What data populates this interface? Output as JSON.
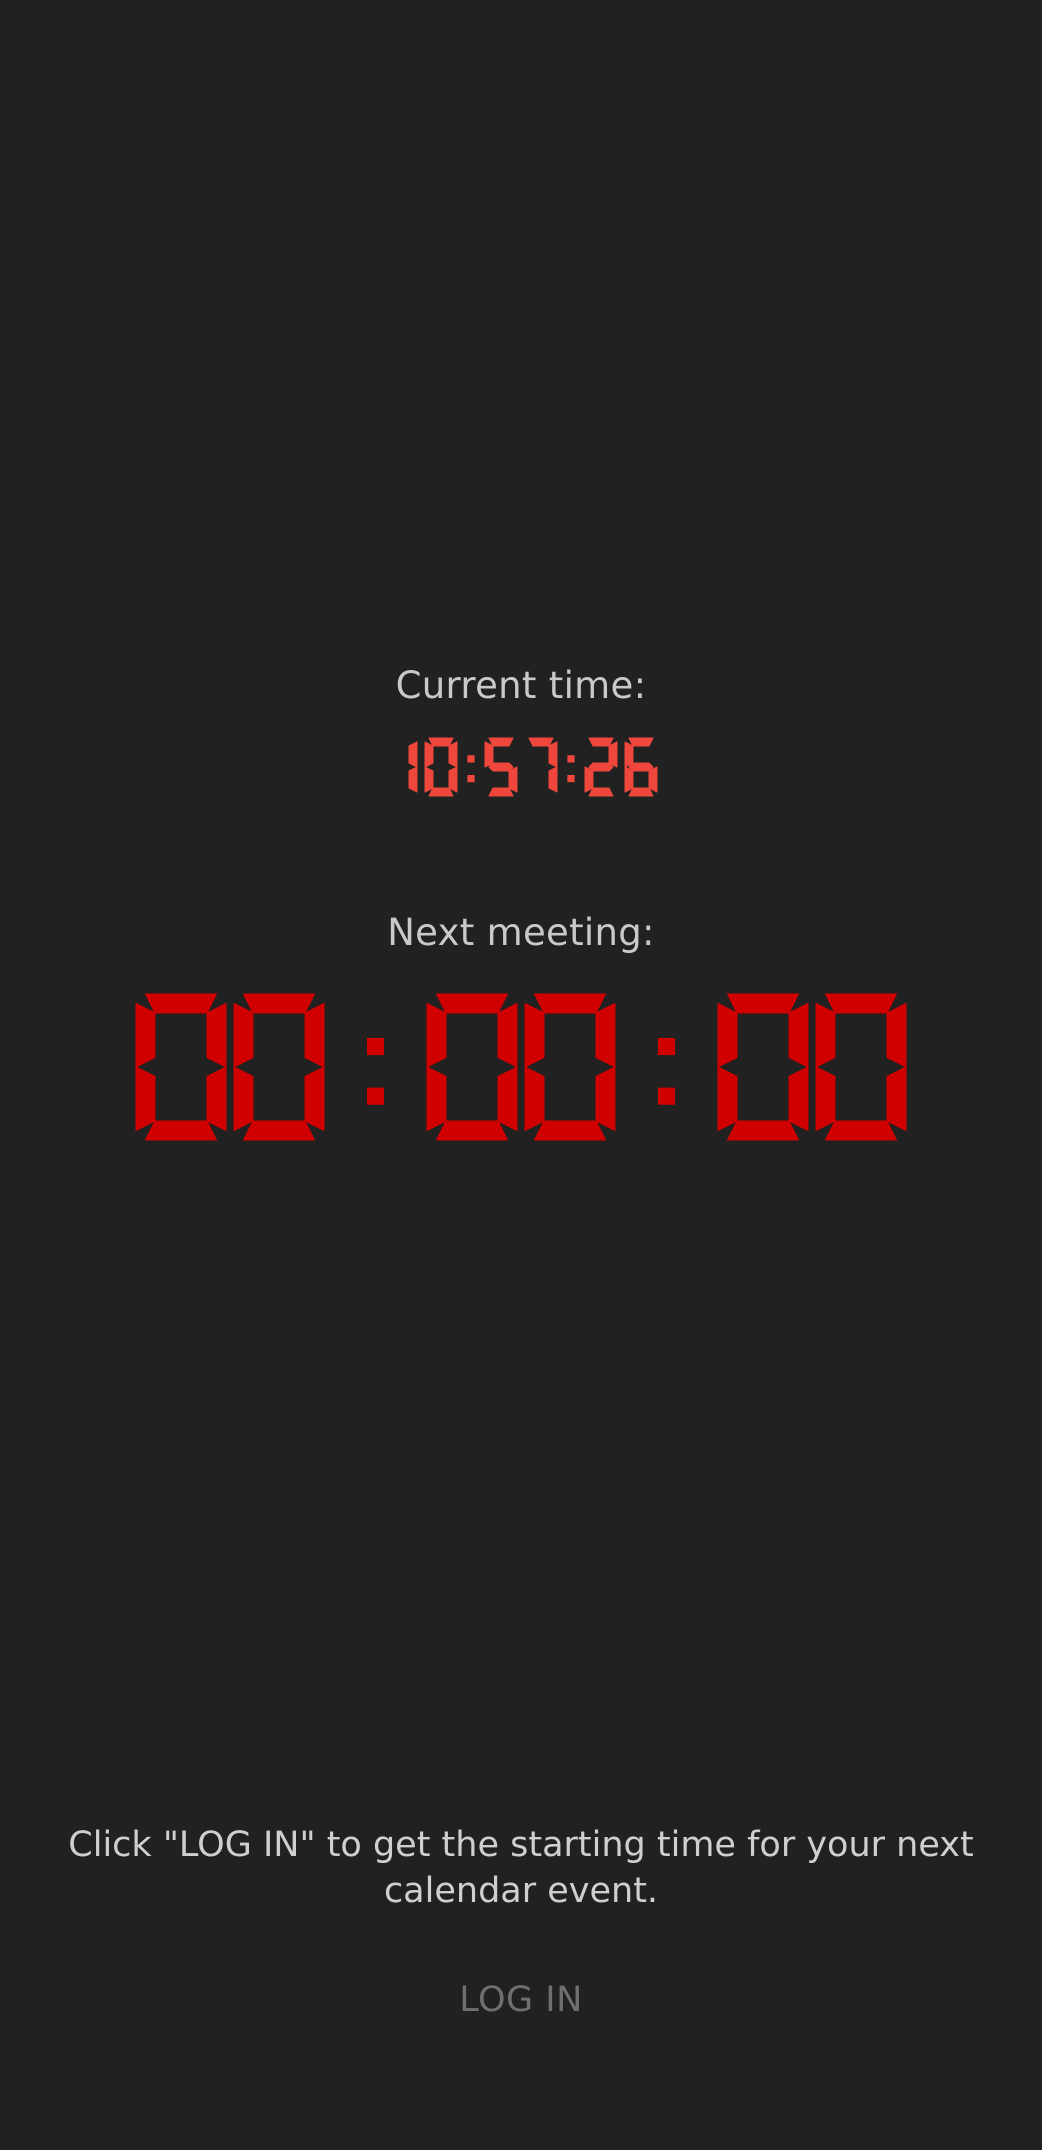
{
  "labels": {
    "current_time": "Current time:",
    "next_meeting": "Next meeting:"
  },
  "current_time": "10:57:26",
  "next_meeting_countdown": "00:00:00",
  "help_text": "Click \"LOG IN\" to get the starting time for your next calendar event.",
  "login_button": "LOG IN",
  "colors": {
    "background": "#212121",
    "clock": "#f0473c",
    "countdown": "#d10000",
    "label_text": "#c9c9c9",
    "button_text": "#6f6f6f"
  }
}
